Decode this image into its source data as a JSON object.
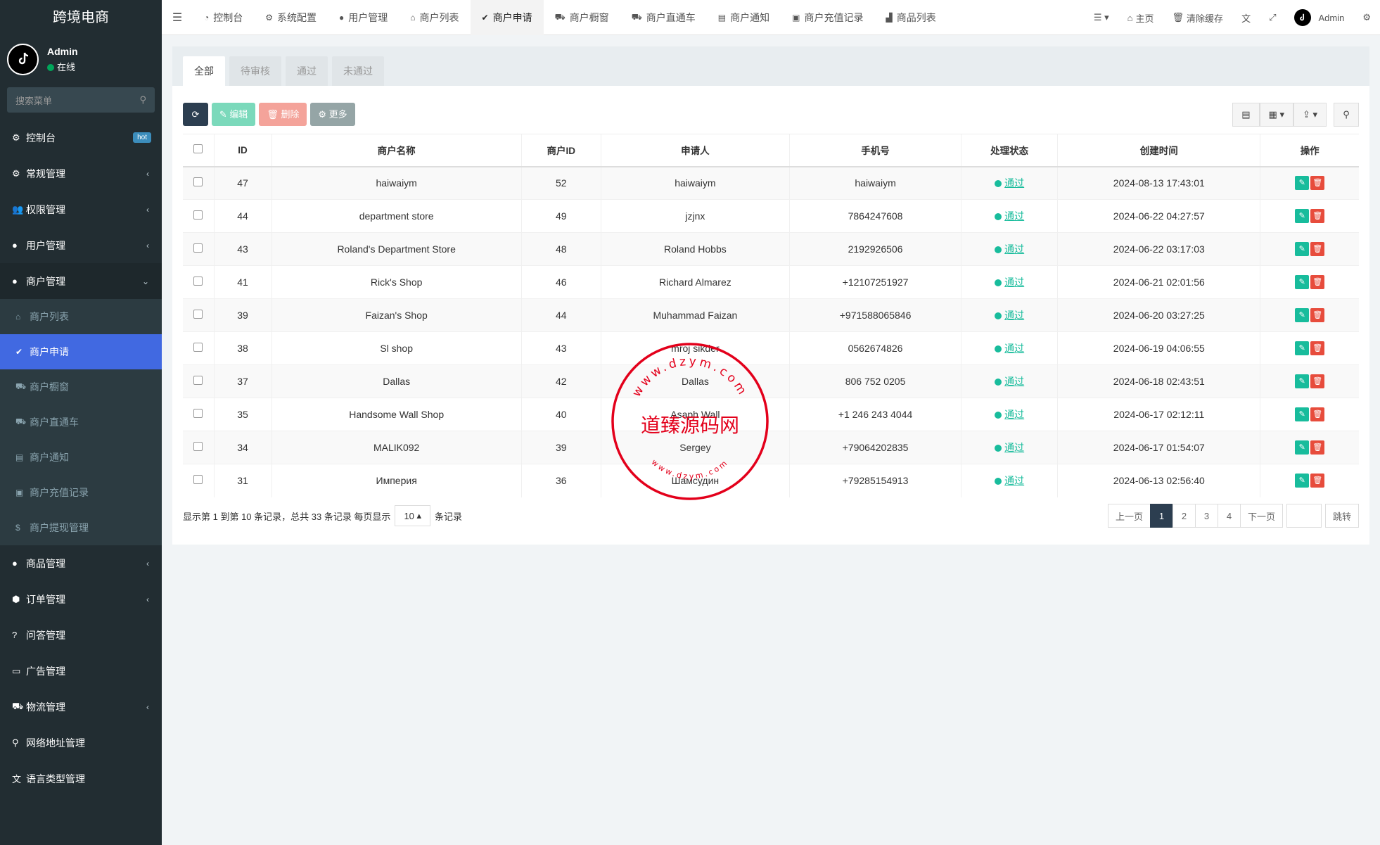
{
  "brand": "跨境电商",
  "user": {
    "name": "Admin",
    "status": "在线"
  },
  "sidebar_search_placeholder": "搜索菜单",
  "menu": [
    {
      "label": "控制台",
      "icon": "dashboard-icon",
      "glyph": "⚙",
      "badge": "hot"
    },
    {
      "label": "常规管理",
      "icon": "cogs-icon",
      "glyph": "⚙",
      "arrow": "‹"
    },
    {
      "label": "权限管理",
      "icon": "group-icon",
      "glyph": "👥",
      "arrow": "‹"
    },
    {
      "label": "用户管理",
      "icon": "user-circle-icon",
      "glyph": "●",
      "arrow": "‹"
    },
    {
      "label": "商户管理",
      "icon": "apple-icon",
      "glyph": "●",
      "arrow": "⌄"
    }
  ],
  "submenu": [
    {
      "label": "商户列表",
      "icon": "home-icon",
      "glyph": "⌂"
    },
    {
      "label": "商户申请",
      "icon": "check-circle-icon",
      "glyph": "✔"
    },
    {
      "label": "商户橱窗",
      "icon": "cart-icon",
      "glyph": "⛟"
    },
    {
      "label": "商户直通车",
      "icon": "car-icon",
      "glyph": "⛟"
    },
    {
      "label": "商户通知",
      "icon": "list-alt-icon",
      "glyph": "▤"
    },
    {
      "label": "商户充值记录",
      "icon": "money-icon",
      "glyph": "▣"
    },
    {
      "label": "商户提现管理",
      "icon": "dollar-icon",
      "glyph": "$"
    }
  ],
  "menu2": [
    {
      "label": "商品管理",
      "icon": "product-icon",
      "glyph": "●",
      "arrow": "‹"
    },
    {
      "label": "订单管理",
      "icon": "cube-icon",
      "glyph": "⬢",
      "arrow": "‹"
    },
    {
      "label": "问答管理",
      "icon": "question-icon",
      "glyph": "?",
      "arrow": ""
    },
    {
      "label": "广告管理",
      "icon": "ad-icon",
      "glyph": "▭",
      "arrow": ""
    },
    {
      "label": "物流管理",
      "icon": "truck-icon",
      "glyph": "⛟",
      "arrow": "‹"
    },
    {
      "label": "网络地址管理",
      "icon": "link-icon",
      "glyph": "⚲",
      "arrow": ""
    },
    {
      "label": "语言类型管理",
      "icon": "language-icon",
      "glyph": "文",
      "arrow": ""
    }
  ],
  "top_tabs": [
    {
      "label": "控制台",
      "icon": "dashboard-icon",
      "glyph": "◔"
    },
    {
      "label": "系统配置",
      "icon": "cog-icon",
      "glyph": "⚙"
    },
    {
      "label": "用户管理",
      "icon": "user-icon",
      "glyph": "●"
    },
    {
      "label": "商户列表",
      "icon": "home-icon",
      "glyph": "⌂"
    },
    {
      "label": "商户申请",
      "icon": "check-circle-icon",
      "glyph": "✔"
    },
    {
      "label": "商户橱窗",
      "icon": "cart-icon",
      "glyph": "⛟"
    },
    {
      "label": "商户直通车",
      "icon": "car-icon",
      "glyph": "⛟"
    },
    {
      "label": "商户通知",
      "icon": "list-alt-icon",
      "glyph": "▤"
    },
    {
      "label": "商户充值记录",
      "icon": "money-icon",
      "glyph": "▣"
    },
    {
      "label": "商品列表",
      "icon": "shopping-bag-icon",
      "glyph": "▟"
    }
  ],
  "top_right": {
    "home": "主页",
    "clear_cache": "清除缓存",
    "admin": "Admin"
  },
  "status_tabs": [
    "全部",
    "待审核",
    "通过",
    "未通过"
  ],
  "buttons": {
    "edit": "编辑",
    "delete": "删除",
    "more": "更多"
  },
  "table": {
    "headers": [
      "ID",
      "商户名称",
      "商户ID",
      "申请人",
      "手机号",
      "处理状态",
      "创建时间",
      "操作"
    ],
    "rows": [
      {
        "id": "47",
        "name": "haiwaiym",
        "mid": "52",
        "applicant": "haiwaiym",
        "phone": "haiwaiym",
        "status": "通过",
        "time": "2024-08-13 17:43:01"
      },
      {
        "id": "44",
        "name": "department store",
        "mid": "49",
        "applicant": "jzjnx",
        "phone": "7864247608",
        "status": "通过",
        "time": "2024-06-22 04:27:57"
      },
      {
        "id": "43",
        "name": "Roland's Department Store",
        "mid": "48",
        "applicant": "Roland Hobbs",
        "phone": "2192926506",
        "status": "通过",
        "time": "2024-06-22 03:17:03"
      },
      {
        "id": "41",
        "name": "Rick's Shop",
        "mid": "46",
        "applicant": "Richard Almarez",
        "phone": "+12107251927",
        "status": "通过",
        "time": "2024-06-21 02:01:56"
      },
      {
        "id": "39",
        "name": "Faizan's Shop",
        "mid": "44",
        "applicant": "Muhammad Faizan",
        "phone": "+971588065846",
        "status": "通过",
        "time": "2024-06-20 03:27:25"
      },
      {
        "id": "38",
        "name": "Sl shop",
        "mid": "43",
        "applicant": "mroj sikder",
        "phone": "0562674826",
        "status": "通过",
        "time": "2024-06-19 04:06:55"
      },
      {
        "id": "37",
        "name": "Dallas",
        "mid": "42",
        "applicant": "Dallas",
        "phone": "806 752 0205",
        "status": "通过",
        "time": "2024-06-18 02:43:51"
      },
      {
        "id": "35",
        "name": "Handsome Wall Shop",
        "mid": "40",
        "applicant": "Asaph Wall",
        "phone": "+1 246 243 4044",
        "status": "通过",
        "time": "2024-06-17 02:12:11"
      },
      {
        "id": "34",
        "name": "MALIK092",
        "mid": "39",
        "applicant": "Sergey",
        "phone": "+79064202835",
        "status": "通过",
        "time": "2024-06-17 01:54:07"
      },
      {
        "id": "31",
        "name": "Империя",
        "mid": "36",
        "applicant": "Шамсудин",
        "phone": "+79285154913",
        "status": "通过",
        "time": "2024-06-13 02:56:40"
      }
    ]
  },
  "footer": {
    "summary": "显示第 1 到第 10 条记录，总共 33 条记录 每页显示",
    "page_size": "10",
    "suffix": "条记录"
  },
  "pager": {
    "prev": "上一页",
    "pages": [
      "1",
      "2",
      "3",
      "4"
    ],
    "current": "1",
    "next": "下一页",
    "go": "跳转"
  },
  "watermark": {
    "text": "道臻源码网",
    "url": "www.dzym.com"
  }
}
